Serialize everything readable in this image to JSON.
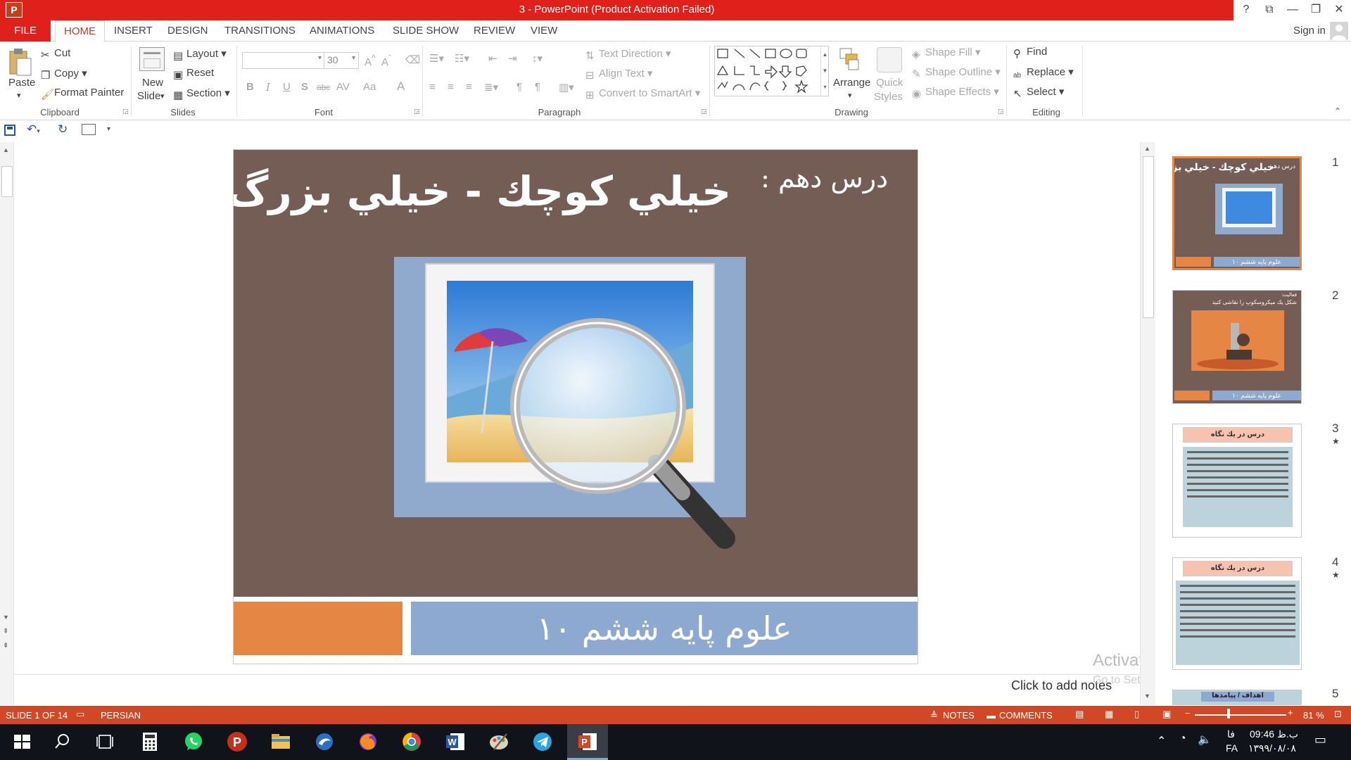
{
  "window": {
    "title": "3 -  PowerPoint (Product Activation Failed)",
    "app_icon": "P",
    "controls": [
      "?",
      "⧉",
      "—",
      "❐",
      "✕"
    ]
  },
  "tabs": [
    {
      "label": "FILE"
    },
    {
      "label": "HOME"
    },
    {
      "label": "INSERT"
    },
    {
      "label": "DESIGN"
    },
    {
      "label": "TRANSITIONS"
    },
    {
      "label": "ANIMATIONS"
    },
    {
      "label": "SLIDE SHOW"
    },
    {
      "label": "REVIEW"
    },
    {
      "label": "VIEW"
    }
  ],
  "signin": "Sign in",
  "ribbon": {
    "clipboard": {
      "label": "Clipboard",
      "paste": "Paste",
      "cut": "Cut",
      "copy": "Copy",
      "format_painter": "Format Painter"
    },
    "slides": {
      "label": "Slides",
      "new_slide_1": "New",
      "new_slide_2": "Slide",
      "layout": "Layout",
      "reset": "Reset",
      "section": "Section"
    },
    "font": {
      "label": "Font",
      "size": "30",
      "buttons": [
        "B",
        "I",
        "U",
        "S",
        "abc",
        "AV",
        "Aa",
        "A"
      ]
    },
    "paragraph": {
      "label": "Paragraph",
      "text_direction": "Text Direction",
      "align_text": "Align Text",
      "convert_smartart": "Convert to SmartArt"
    },
    "drawing": {
      "label": "Drawing",
      "arrange": "Arrange",
      "quick_1": "Quick",
      "quick_2": "Styles",
      "shape_fill": "Shape Fill",
      "shape_outline": "Shape Outline",
      "shape_effects": "Shape Effects"
    },
    "editing": {
      "label": "Editing",
      "find": "Find",
      "replace": "Replace",
      "select": "Select"
    }
  },
  "slide": {
    "title_small": "درس دهم :",
    "title_main": "خيلي كوچك - خيلي بزرگ",
    "footer": "علوم پايه ششم   ۱۰"
  },
  "notes_placeholder": "Click to add notes",
  "watermark": {
    "line1": "Activate Windows",
    "line2": "Go to Settings to activate Windows."
  },
  "thumbnails": [
    {
      "num": "1",
      "title": "خيلي كوچك - خيلي بزرگ",
      "sub": "درس دهم",
      "footer": "علوم پايه ششم  ۱۰"
    },
    {
      "num": "2",
      "title": "شكل يك ميكروسكوپ را نقاشی كنيد",
      "sub": "فعاليت:",
      "footer": "علوم پايه ششم  ۱۰"
    },
    {
      "num": "3",
      "star": "★",
      "title": "درس در يك نگاه"
    },
    {
      "num": "4",
      "star": "★",
      "title": "درس در يك نگاه"
    },
    {
      "num": "5",
      "title": "اهداف / پيامدها"
    }
  ],
  "status": {
    "slide_of": "SLIDE 1 OF 14",
    "language": "PERSIAN",
    "notes": "NOTES",
    "comments": "COMMENTS",
    "zoom": "81 %"
  },
  "taskbar": {
    "time": "09:46 ب.ظ",
    "date": "۱۳۹۹/۰۸/۰۸",
    "lang1": "فا",
    "lang2": "FA"
  },
  "colors": {
    "accent": "#d24726",
    "title_red": "#e0201b",
    "slide_bg": "#745d54",
    "orange": "#e58644",
    "blue": "#8ea9cf"
  }
}
